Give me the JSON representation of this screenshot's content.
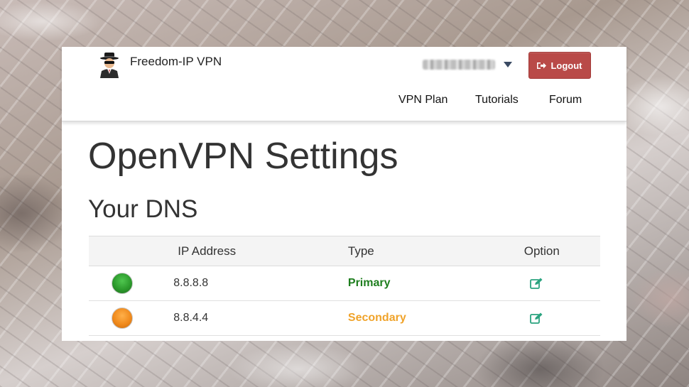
{
  "brand": {
    "name": "Freedom-IP VPN",
    "logo_icon": "spy-avatar-icon"
  },
  "header": {
    "logout_label": "Logout",
    "logout_color": "#b94a48",
    "nav": [
      {
        "label": "VPN Plan"
      },
      {
        "label": "Tutorials"
      },
      {
        "label": "Forum"
      }
    ]
  },
  "page": {
    "title": "OpenVPN Settings",
    "section_title": "Your DNS"
  },
  "dns_table": {
    "headers": {
      "status": "",
      "ip": "IP Address",
      "type": "Type",
      "option": "Option"
    },
    "rows": [
      {
        "status_color": "#2c9a2c",
        "ip": "8.8.8.8",
        "type": "Primary",
        "type_color": "#1e7e1e",
        "option_icon": "edit-icon"
      },
      {
        "status_color": "#f08a1c",
        "ip": "8.8.4.4",
        "type": "Secondary",
        "type_color": "#f0a32a",
        "option_icon": "edit-icon"
      }
    ]
  }
}
